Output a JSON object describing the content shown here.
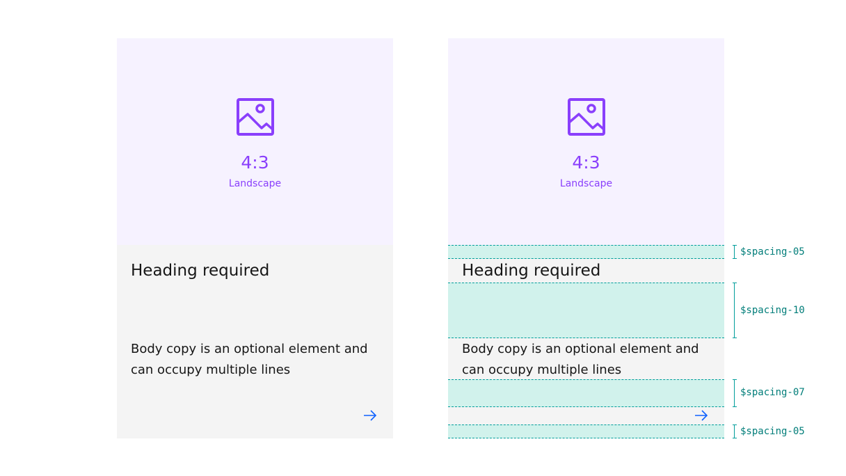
{
  "cards": [
    {
      "media": {
        "icon": "image-icon",
        "ratio": "4:3",
        "orientation": "Landscape",
        "accent_color": "#8a3ffc",
        "background_color": "#f6f2ff"
      },
      "heading": "Heading required",
      "body": "Body copy is an optional element and can occupy multiple lines",
      "action_icon": "arrow-right-icon"
    },
    {
      "media": {
        "icon": "image-icon",
        "ratio": "4:3",
        "orientation": "Landscape",
        "accent_color": "#8a3ffc",
        "background_color": "#f6f2ff"
      },
      "heading": "Heading required",
      "body": "Body copy is an optional element and can occupy multiple lines",
      "action_icon": "arrow-right-icon"
    }
  ],
  "spacing_annotations": [
    {
      "label": "$spacing-05"
    },
    {
      "label": "$spacing-10"
    },
    {
      "label": "$spacing-07"
    },
    {
      "label": "$spacing-05"
    }
  ],
  "colors": {
    "card_background": "#f4f4f4",
    "link_blue": "#0f62fe",
    "spacing_teal": "#009d9a"
  }
}
